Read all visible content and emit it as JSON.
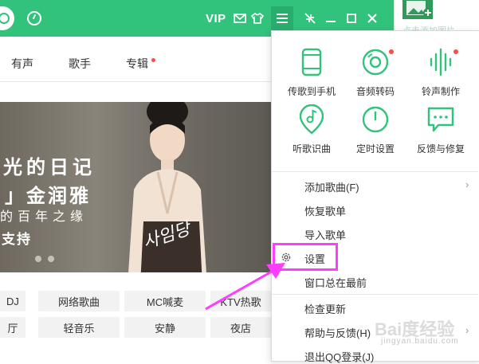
{
  "topbar": {
    "vip_label": "VIP",
    "icons": [
      "clock-icon",
      "mail-icon",
      "shirt-icon",
      "menu-icon",
      "collapse-icon",
      "minimize-icon",
      "maximize-icon",
      "close-icon"
    ]
  },
  "addpic": {
    "label": "点击添加图片"
  },
  "nav": {
    "tabs": [
      "有声",
      "歌手",
      "专辑"
    ]
  },
  "banner": {
    "line1": "光的日记",
    "line2": "」金润雅",
    "line3": "的百年之缘",
    "line4": "支持",
    "script": "사임당"
  },
  "tags": {
    "row1": [
      "DJ",
      "网络歌曲",
      "MC喊麦",
      "KTV热歌"
    ],
    "row2": [
      "厅",
      "轻音乐",
      "安静",
      "夜店"
    ]
  },
  "menu": {
    "grid": [
      {
        "label": "传歌到手机",
        "icon": "phone-icon",
        "red_dot": false
      },
      {
        "label": "音频转码",
        "icon": "disc-icon",
        "red_dot": true
      },
      {
        "label": "铃声制作",
        "icon": "waveform-icon",
        "red_dot": true
      },
      {
        "label": "听歌识曲",
        "icon": "music-note-icon",
        "red_dot": false
      },
      {
        "label": "定时设置",
        "icon": "power-icon",
        "red_dot": false
      },
      {
        "label": "反馈与修复",
        "icon": "chat-icon",
        "red_dot": false
      }
    ],
    "items": {
      "add_songs": "添加歌曲(F)",
      "restore_list": "恢复歌单",
      "import_list": "导入歌单",
      "settings": "设置",
      "always_on_top": "窗口总在最前",
      "check_update": "检查更新",
      "help_feedback": "帮助与反馈(H)",
      "logout": "退出QQ登录(J)"
    }
  },
  "watermark": {
    "main": "Bai度经验",
    "sub": "jingyan.baidu.com"
  },
  "colors": {
    "accent": "#31c27c",
    "highlight": "#ff3cff",
    "reddot": "#ff4a4a"
  }
}
